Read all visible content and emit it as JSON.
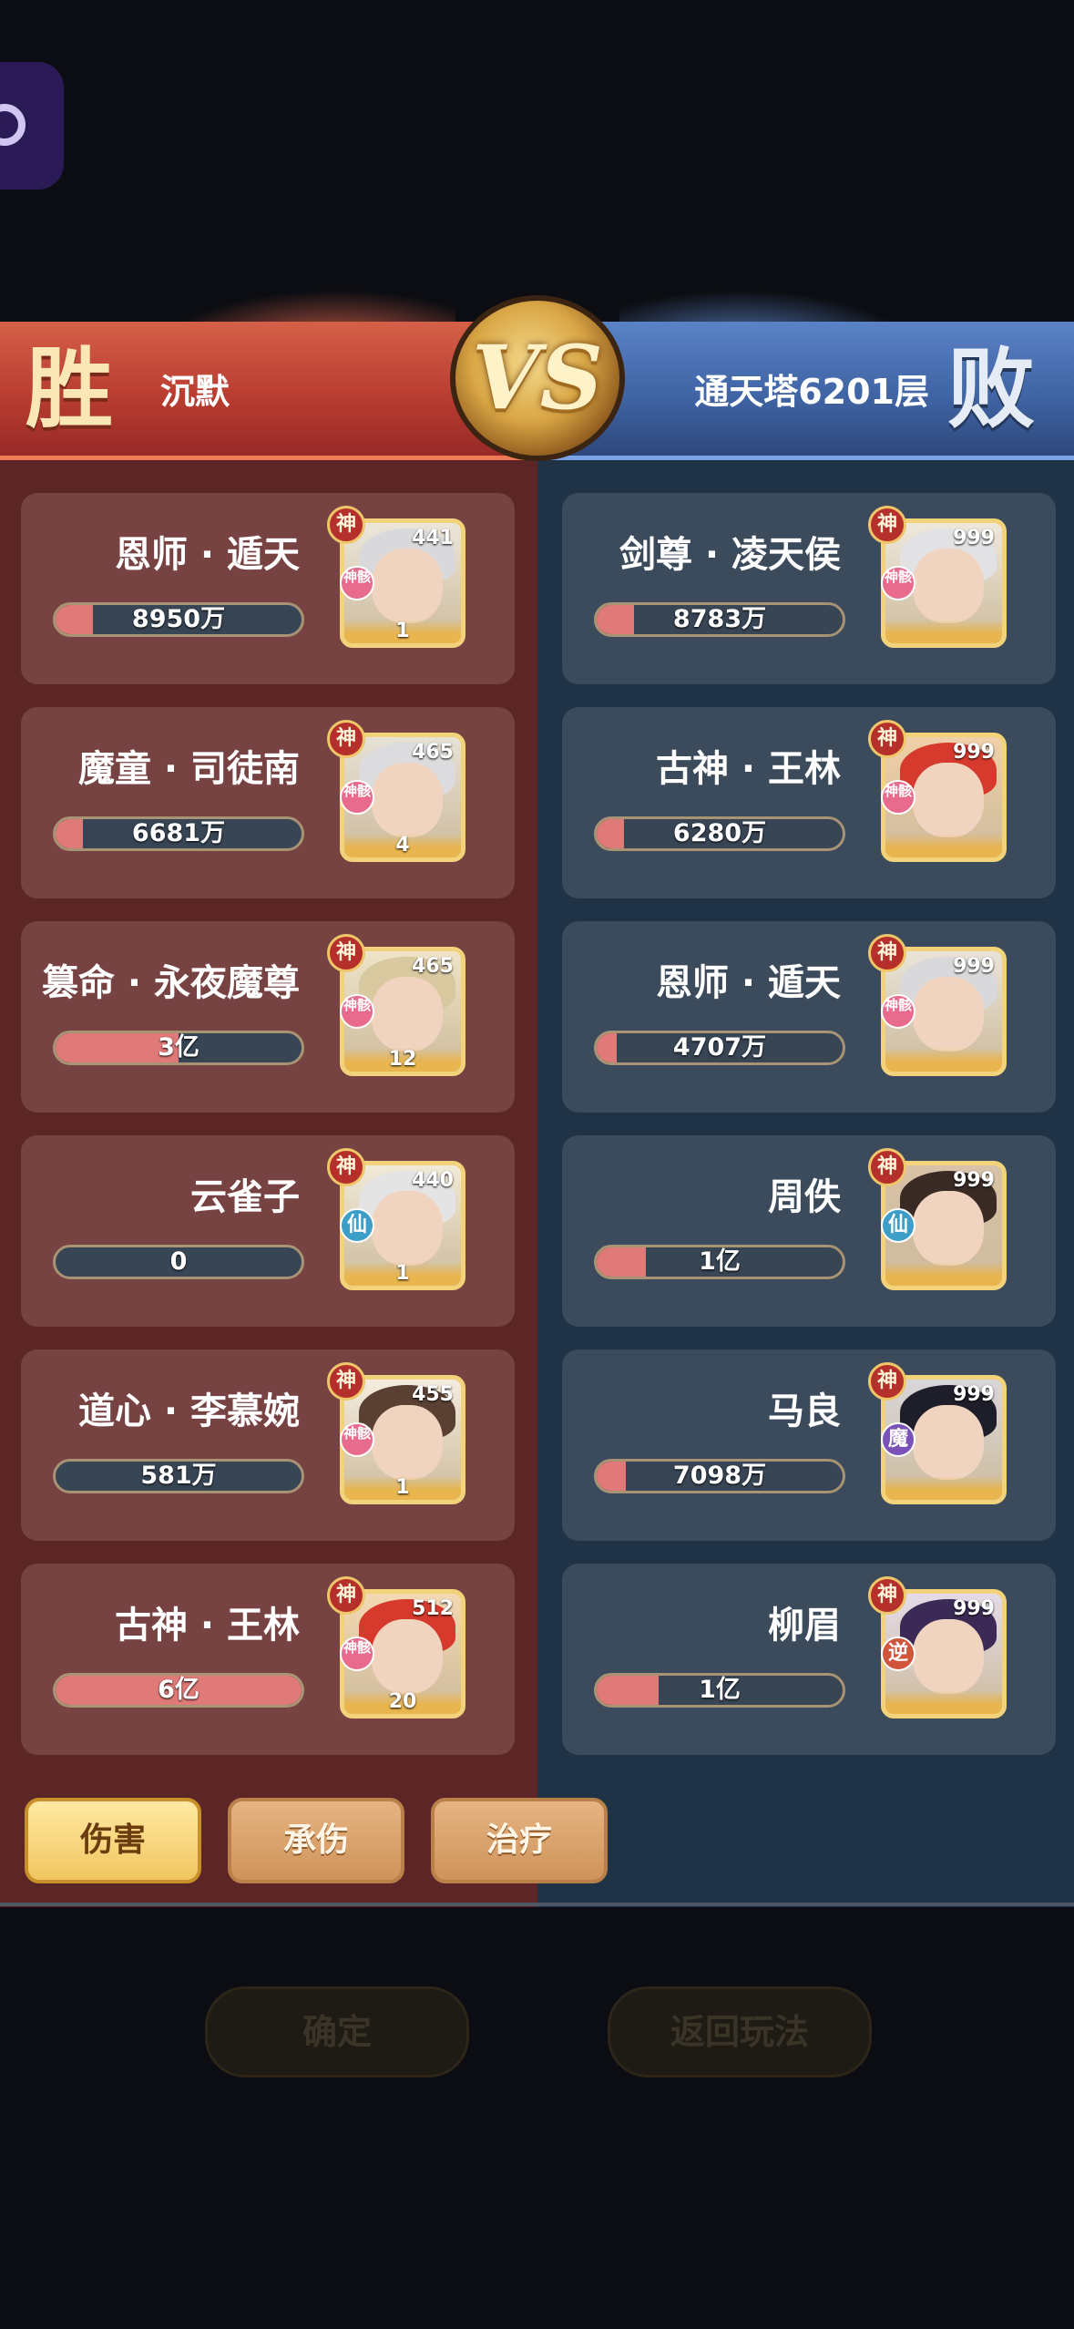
{
  "header": {
    "win_label": "胜",
    "lose_label": "败",
    "vs_label": "VS",
    "left_player": "沉默",
    "right_player": "通天塔6201层"
  },
  "colors": {
    "left_panel": "#5c2526",
    "right_panel": "#1f3246",
    "bar_fill": "#e07a78",
    "tab_active": "#f1c660"
  },
  "left_team": [
    {
      "name": "恩师 · 遁天",
      "value": "8950万",
      "fill_fraction": 0.15,
      "power": "441",
      "level": "1",
      "faction": "神骸",
      "hair": "#d9d9dc",
      "bg": "#ece6da"
    },
    {
      "name": "魔童 · 司徒南",
      "value": "6681万",
      "fill_fraction": 0.11,
      "power": "465",
      "level": "4",
      "faction": "神骸",
      "hair": "#dcdcdf",
      "bg": "#e7e1d6"
    },
    {
      "name": "篡命 · 永夜魔尊",
      "value": "3亿",
      "fill_fraction": 0.5,
      "power": "465",
      "level": "12",
      "faction": "神骸",
      "hair": "#d9c9a0",
      "bg": "#efe4c8"
    },
    {
      "name": "云雀子",
      "value": "0",
      "fill_fraction": 0.0,
      "power": "440",
      "level": "1",
      "faction": "仙",
      "hair": "#e4e4e4",
      "bg": "#f1ead8"
    },
    {
      "name": "道心 · 李慕婉",
      "value": "581万",
      "fill_fraction": 0.0,
      "power": "455",
      "level": "1",
      "faction": "神骸",
      "hair": "#5a4032",
      "bg": "#f4ecdf"
    },
    {
      "name": "古神 · 王林",
      "value": "6亿",
      "fill_fraction": 1.0,
      "power": "512",
      "level": "20",
      "faction": "神骸",
      "hair": "#d63a2c",
      "bg": "#f3d9b2"
    }
  ],
  "right_team": [
    {
      "name": "剑尊 · 凌天侯",
      "value": "8783万",
      "fill_fraction": 0.15,
      "power": "999",
      "level": "",
      "faction": "神骸",
      "hair": "#e2e2e4",
      "bg": "#eee8dc"
    },
    {
      "name": "古神 · 王林",
      "value": "6280万",
      "fill_fraction": 0.11,
      "power": "999",
      "level": "",
      "faction": "神骸",
      "hair": "#d63a2c",
      "bg": "#f0d0a8"
    },
    {
      "name": "恩师 · 遁天",
      "value": "4707万",
      "fill_fraction": 0.08,
      "power": "999",
      "level": "",
      "faction": "神骸",
      "hair": "#d9d9dc",
      "bg": "#e9e3d8"
    },
    {
      "name": "周佚",
      "value": "1亿",
      "fill_fraction": 0.2,
      "power": "999",
      "level": "",
      "faction": "仙",
      "hair": "#3a2a24",
      "bg": "#d8c2a8"
    },
    {
      "name": "马良",
      "value": "7098万",
      "fill_fraction": 0.12,
      "power": "999",
      "level": "",
      "faction": "魔",
      "hair": "#1e1e2a",
      "bg": "#d9d6da"
    },
    {
      "name": "柳眉",
      "value": "1亿",
      "fill_fraction": 0.25,
      "power": "999",
      "level": "",
      "faction": "逆",
      "hair": "#3b2a55",
      "bg": "#e4dbe8"
    }
  ],
  "tabs": [
    "伤害",
    "承伤",
    "治疗"
  ],
  "active_tab": "伤害",
  "portrait_badge": "神",
  "buttons": {
    "confirm": "确定",
    "back": "返回玩法"
  }
}
